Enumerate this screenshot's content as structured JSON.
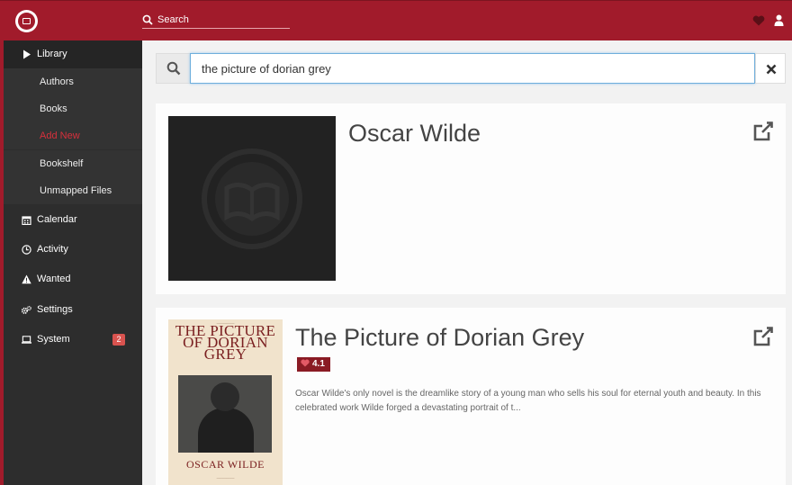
{
  "header": {
    "search_placeholder": "Search",
    "icons": [
      "app-logo",
      "search-icon",
      "heart-icon",
      "user-icon"
    ],
    "brand_color": "#a11b2b"
  },
  "sidebar": {
    "library": "Library",
    "sub_items": [
      {
        "label": "Authors"
      },
      {
        "label": "Books"
      },
      {
        "label": "Add New",
        "active": true
      },
      {
        "label": "Bookshelf"
      },
      {
        "label": "Unmapped Files"
      }
    ],
    "items": [
      {
        "label": "Calendar",
        "icon": "calendar-icon"
      },
      {
        "label": "Activity",
        "icon": "clock-icon"
      },
      {
        "label": "Wanted",
        "icon": "warning-icon"
      },
      {
        "label": "Settings",
        "icon": "cogs-icon"
      },
      {
        "label": "System",
        "icon": "laptop-icon",
        "badge": "2"
      }
    ],
    "active_color": "#d7303c"
  },
  "search": {
    "query": "the picture of dorian grey"
  },
  "results": {
    "author": {
      "name": "Oscar Wilde"
    },
    "book": {
      "title": "The Picture of Dorian Grey",
      "rating": "4.1",
      "overview": "Oscar Wilde's only novel is the dreamlike story of a young man who sells his soul for eternal youth and beauty. In this celebrated work Wilde forged a devastating portrait of t...",
      "cover_title": "The Picture Of Dorian Grey",
      "cover_author": "Oscar Wilde"
    }
  }
}
